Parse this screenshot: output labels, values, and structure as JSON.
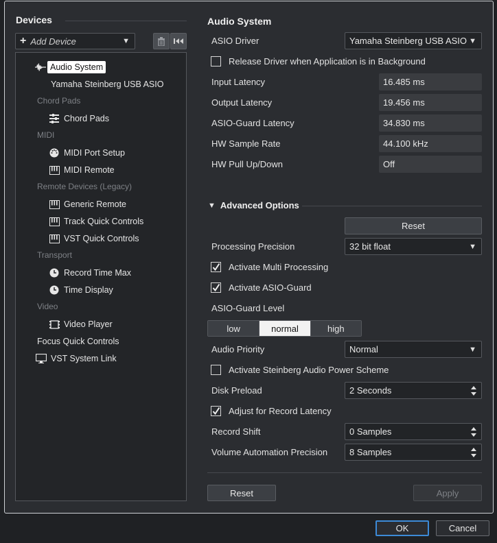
{
  "devices": {
    "header": "Devices",
    "add_device_label": "Add Device",
    "tree": {
      "audio_system": "Audio System",
      "yamaha_driver": "Yamaha Steinberg USB ASIO",
      "cat_chord_pads": "Chord Pads",
      "chord_pads": "Chord Pads",
      "cat_midi": "MIDI",
      "midi_port_setup": "MIDI Port Setup",
      "midi_remote": "MIDI Remote",
      "cat_remote_legacy": "Remote Devices (Legacy)",
      "generic_remote": "Generic Remote",
      "track_quick_controls": "Track Quick Controls",
      "vst_quick_controls": "VST Quick Controls",
      "cat_transport": "Transport",
      "record_time_max": "Record Time Max",
      "time_display": "Time Display",
      "cat_video": "Video",
      "video_player": "Video Player",
      "focus_quick_controls": "Focus Quick Controls",
      "vst_system_link": "VST System Link"
    }
  },
  "audio": {
    "title": "Audio System",
    "asio_driver_label": "ASIO Driver",
    "asio_driver_value": "Yamaha Steinberg USB ASIO",
    "release_driver_label": "Release Driver when Application is in Background",
    "input_latency_label": "Input Latency",
    "input_latency_value": "16.485 ms",
    "output_latency_label": "Output Latency",
    "output_latency_value": "19.456 ms",
    "asio_guard_latency_label": "ASIO-Guard Latency",
    "asio_guard_latency_value": "34.830 ms",
    "hw_sample_rate_label": "HW Sample Rate",
    "hw_sample_rate_value": "44.100 kHz",
    "hw_pull_label": "HW Pull Up/Down",
    "hw_pull_value": "Off"
  },
  "advanced": {
    "title": "Advanced Options",
    "reset_label": "Reset",
    "processing_precision_label": "Processing Precision",
    "processing_precision_value": "32 bit float",
    "multi_processing_label": "Activate Multi Processing",
    "asio_guard_label": "Activate ASIO-Guard",
    "asio_guard_level_label": "ASIO-Guard Level",
    "level_low": "low",
    "level_normal": "normal",
    "level_high": "high",
    "audio_priority_label": "Audio Priority",
    "audio_priority_value": "Normal",
    "power_scheme_label": "Activate Steinberg Audio Power Scheme",
    "disk_preload_label": "Disk Preload",
    "disk_preload_value": "2 Seconds",
    "adjust_record_latency_label": "Adjust for Record Latency",
    "record_shift_label": "Record Shift",
    "record_shift_value": "0 Samples",
    "volume_automation_label": "Volume Automation Precision",
    "volume_automation_value": "8 Samples"
  },
  "bottom": {
    "reset_label": "Reset",
    "apply_label": "Apply",
    "ok_label": "OK",
    "cancel_label": "Cancel"
  }
}
